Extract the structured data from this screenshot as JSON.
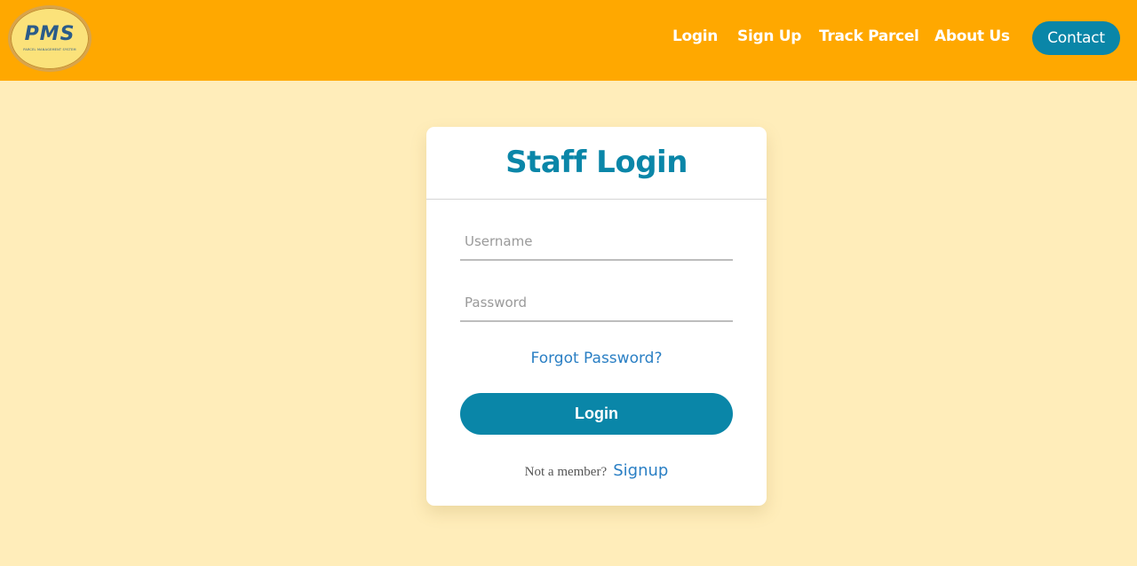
{
  "header": {
    "logo": {
      "title": "PMS",
      "subtitle": "PARCEL MANAGEMENT SYSTEM"
    },
    "nav": {
      "login": "Login",
      "signup": "Sign Up",
      "track": "Track Parcel",
      "about": "About Us",
      "contact": "Contact"
    }
  },
  "login_card": {
    "title": "Staff Login",
    "username_placeholder": "Username",
    "password_placeholder": "Password",
    "forgot_label": "Forgot Password?",
    "submit_label": "Login",
    "not_member_text": "Not a member?",
    "signup_link": "Signup"
  },
  "colors": {
    "nav_background": "#FFA800",
    "page_background": "#FFEDBA",
    "accent": "#0A86A8",
    "link": "#2A7FC4"
  }
}
